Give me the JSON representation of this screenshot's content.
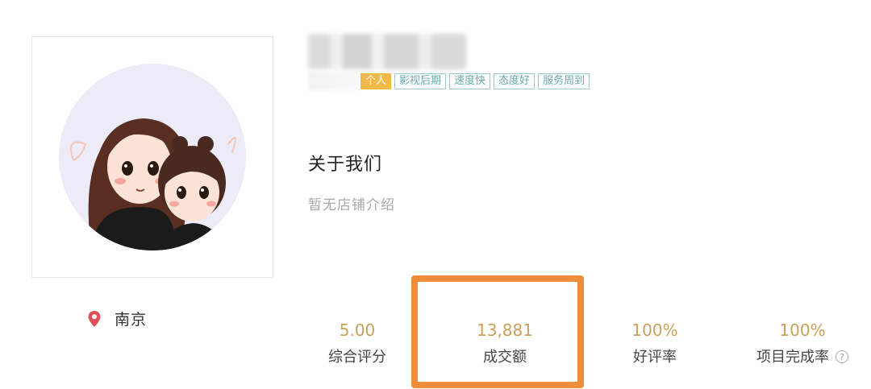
{
  "profile": {
    "city": "南京"
  },
  "tags": [
    "个人",
    "影视后期",
    "速度快",
    "态度好",
    "服务周到"
  ],
  "about": {
    "title": "关于我们",
    "description": "暂无店铺介绍"
  },
  "stats": [
    {
      "value": "5.00",
      "label": "综合评分"
    },
    {
      "value": "13,881",
      "label": "成交额"
    },
    {
      "value": "100%",
      "label": "好评率"
    },
    {
      "value": "100%",
      "label": "项目完成率"
    }
  ],
  "icons": {
    "location": "location-pin-icon",
    "help": "question-circle-icon"
  },
  "colors": {
    "accent_value": "#c9a15b",
    "highlight": "#f08c3a",
    "tag_personal": "#f1b84a",
    "tag_border": "#9cc9c9",
    "pin": "#e0505a"
  }
}
